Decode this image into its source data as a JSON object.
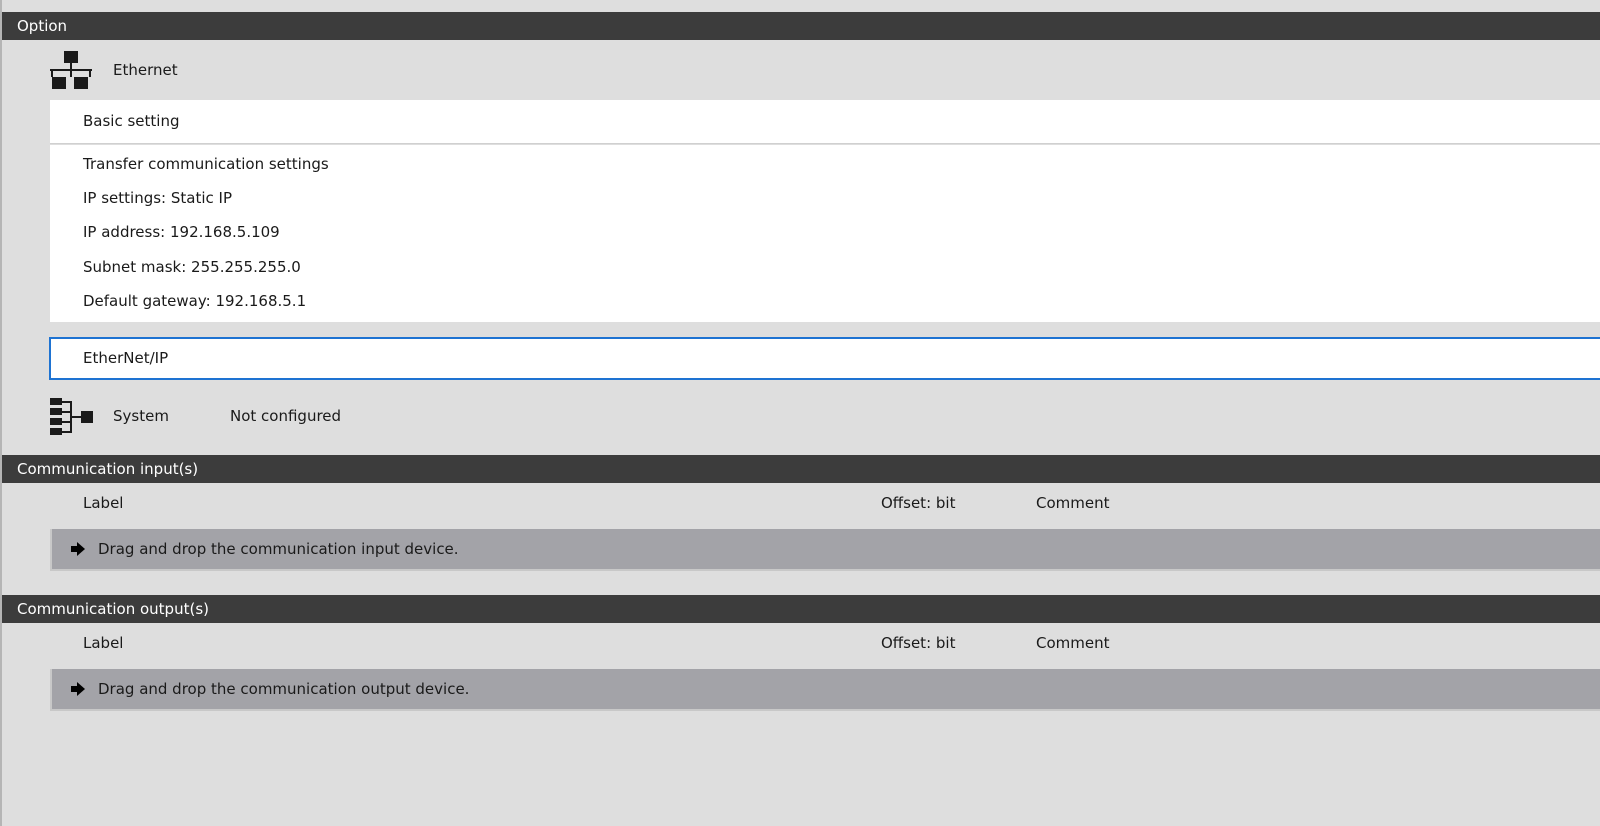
{
  "option": {
    "header": "Option",
    "ethernet": {
      "name": "Ethernet",
      "icon": "network-icon",
      "basic_setting": "Basic setting",
      "details": [
        "Transfer communication settings",
        "IP settings: Static IP",
        "IP address: 192.168.5.109",
        "Subnet mask: 255.255.255.0",
        "Default gateway: 192.168.5.1"
      ],
      "ethernet_ip": "EtherNet/IP"
    },
    "system": {
      "name": "System",
      "icon": "system-tree-icon",
      "status": "Not configured"
    }
  },
  "comm_inputs": {
    "header": "Communication input(s)",
    "columns": {
      "label": "Label",
      "offset": "Offset: bit",
      "comment": "Comment"
    },
    "drop_hint": "Drag and drop the communication input device."
  },
  "comm_outputs": {
    "header": "Communication output(s)",
    "columns": {
      "label": "Label",
      "offset": "Offset: bit",
      "comment": "Comment"
    },
    "drop_hint": "Drag and drop the communication output device."
  },
  "colors": {
    "header_bg": "#3c3c3c",
    "panel_bg": "#dedede",
    "drop_bar_bg": "#a3a3a8",
    "focus_border": "#1e73d2"
  }
}
